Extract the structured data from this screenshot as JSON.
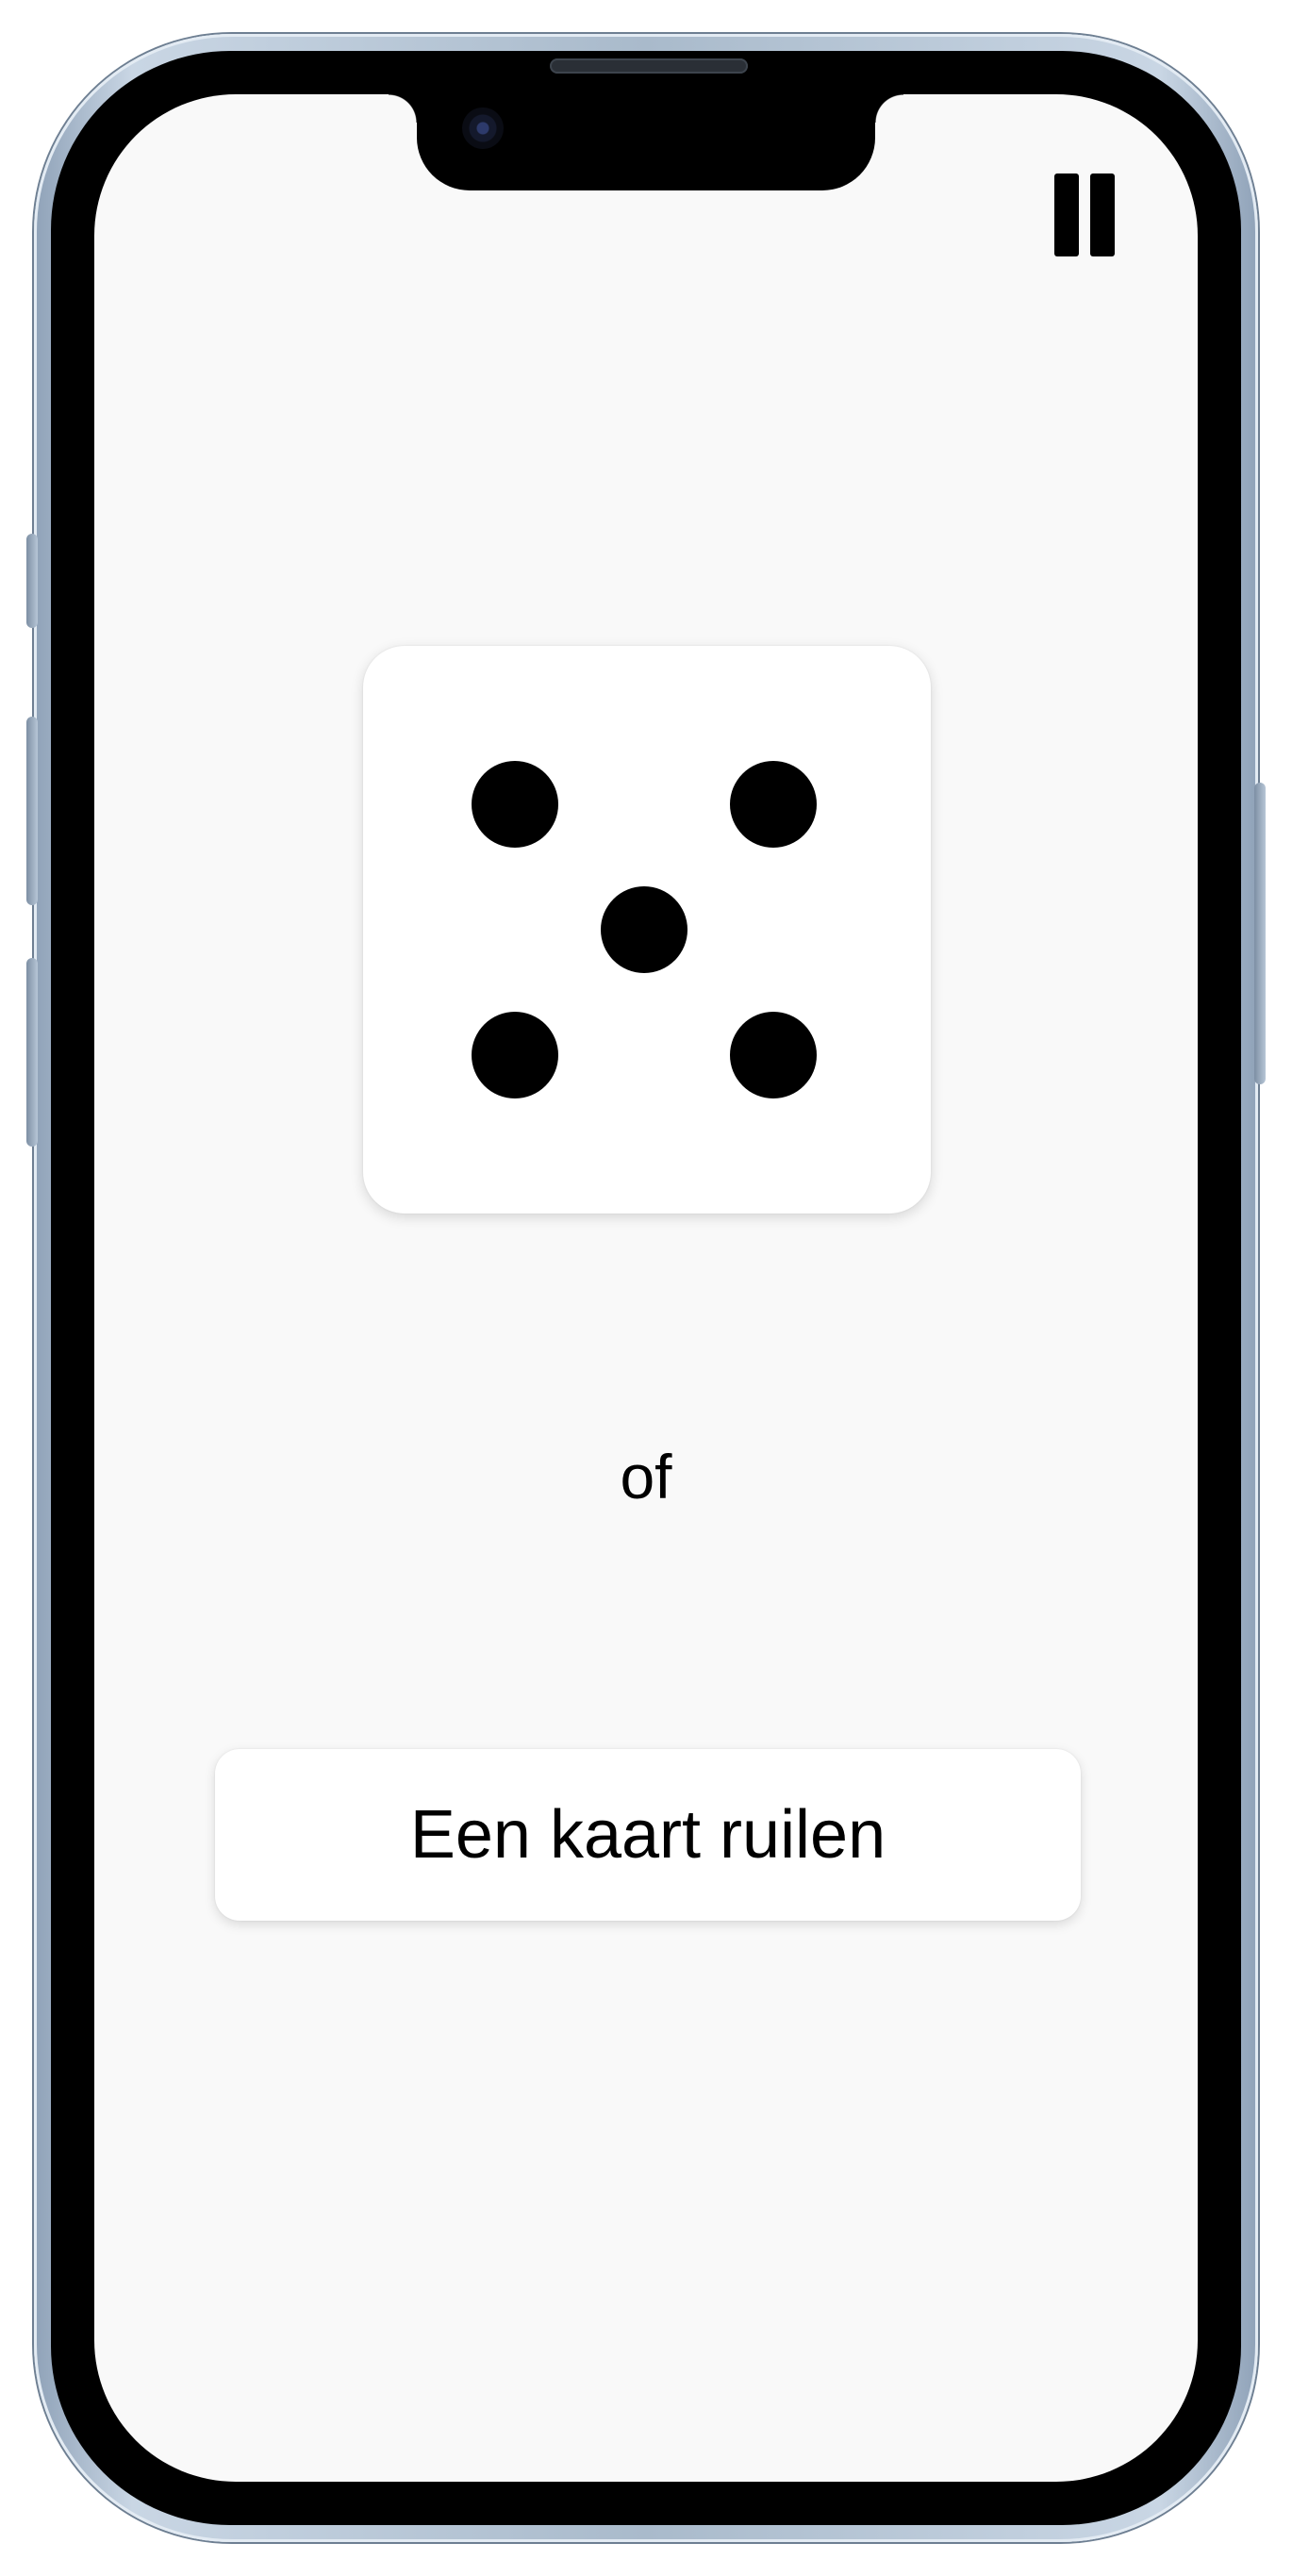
{
  "screen": {
    "background_color": "#f9f9f9"
  },
  "pause": {
    "icon": "pause-icon"
  },
  "die": {
    "value": 5,
    "icon": "die-face-5-icon"
  },
  "separator_text": "of",
  "swap_button": {
    "label": "Een kaart ruilen"
  }
}
